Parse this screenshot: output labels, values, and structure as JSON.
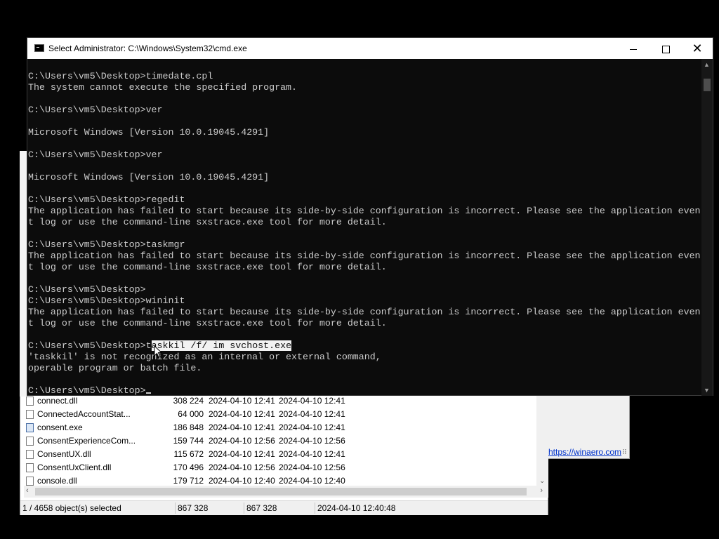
{
  "cmd_window": {
    "title": "Select Administrator: C:\\Windows\\System32\\cmd.exe",
    "lines": [
      {
        "text": "C:\\Users\\vm5\\Desktop>timedate.cpl"
      },
      {
        "text": "The system cannot execute the specified program."
      },
      {
        "text": ""
      },
      {
        "text": "C:\\Users\\vm5\\Desktop>ver"
      },
      {
        "text": ""
      },
      {
        "text": "Microsoft Windows [Version 10.0.19045.4291]"
      },
      {
        "text": ""
      },
      {
        "text": "C:\\Users\\vm5\\Desktop>ver"
      },
      {
        "text": ""
      },
      {
        "text": "Microsoft Windows [Version 10.0.19045.4291]"
      },
      {
        "text": ""
      },
      {
        "text": "C:\\Users\\vm5\\Desktop>regedit"
      },
      {
        "text": "The application has failed to start because its side-by-side configuration is incorrect. Please see the application even"
      },
      {
        "text": "t log or use the command-line sxstrace.exe tool for more detail."
      },
      {
        "text": ""
      },
      {
        "text": "C:\\Users\\vm5\\Desktop>taskmgr"
      },
      {
        "text": "The application has failed to start because its side-by-side configuration is incorrect. Please see the application even"
      },
      {
        "text": "t log or use the command-line sxstrace.exe tool for more detail."
      },
      {
        "text": ""
      },
      {
        "text": "C:\\Users\\vm5\\Desktop>"
      },
      {
        "text": "C:\\Users\\vm5\\Desktop>wininit"
      },
      {
        "text": "The application has failed to start because its side-by-side configuration is incorrect. Please see the application even"
      },
      {
        "text": "t log or use the command-line sxstrace.exe tool for more detail."
      },
      {
        "text": ""
      },
      {
        "prompt": "C:\\Users\\vm5\\Desktop>t",
        "selected": "askkil /f/ im svchost.exe"
      },
      {
        "text": "'taskkil' is not recognized as an internal or external command,"
      },
      {
        "text": "operable program or batch file."
      },
      {
        "text": ""
      },
      {
        "text": "C:\\Users\\vm5\\Desktop>",
        "cursor": true
      }
    ]
  },
  "file_list": {
    "rows": [
      {
        "name": "connect.dll",
        "size": "308 224",
        "date1": "2024-04-10 12:41",
        "date2": "2024-04-10 12:41",
        "icon": "dll-icon"
      },
      {
        "name": "ConnectedAccountStat...",
        "size": "64 000",
        "date1": "2024-04-10 12:41",
        "date2": "2024-04-10 12:41",
        "icon": "dll-icon"
      },
      {
        "name": "consent.exe",
        "size": "186 848",
        "date1": "2024-04-10 12:41",
        "date2": "2024-04-10 12:41",
        "icon": "exe-icon"
      },
      {
        "name": "ConsentExperienceCom...",
        "size": "159 744",
        "date1": "2024-04-10 12:56",
        "date2": "2024-04-10 12:56",
        "icon": "dll-icon"
      },
      {
        "name": "ConsentUX.dll",
        "size": "115 672",
        "date1": "2024-04-10 12:41",
        "date2": "2024-04-10 12:41",
        "icon": "dll-icon"
      },
      {
        "name": "ConsentUxClient.dll",
        "size": "170 496",
        "date1": "2024-04-10 12:56",
        "date2": "2024-04-10 12:56",
        "icon": "dll-icon"
      },
      {
        "name": "console.dll",
        "size": "179 712",
        "date1": "2024-04-10 12:40",
        "date2": "2024-04-10 12:40",
        "icon": "dll-icon"
      }
    ]
  },
  "status_bar": {
    "selection": "1 / 4658 object(s) selected",
    "size1": "867 328",
    "size2": "867 328",
    "datetime": "2024-04-10 12:40:48"
  },
  "side_window": {
    "link": "https://winaero.com"
  },
  "window_controls": {
    "minimize_icon": "minimize-icon",
    "maximize_icon": "maximize-icon",
    "close_glyph": "✕"
  }
}
